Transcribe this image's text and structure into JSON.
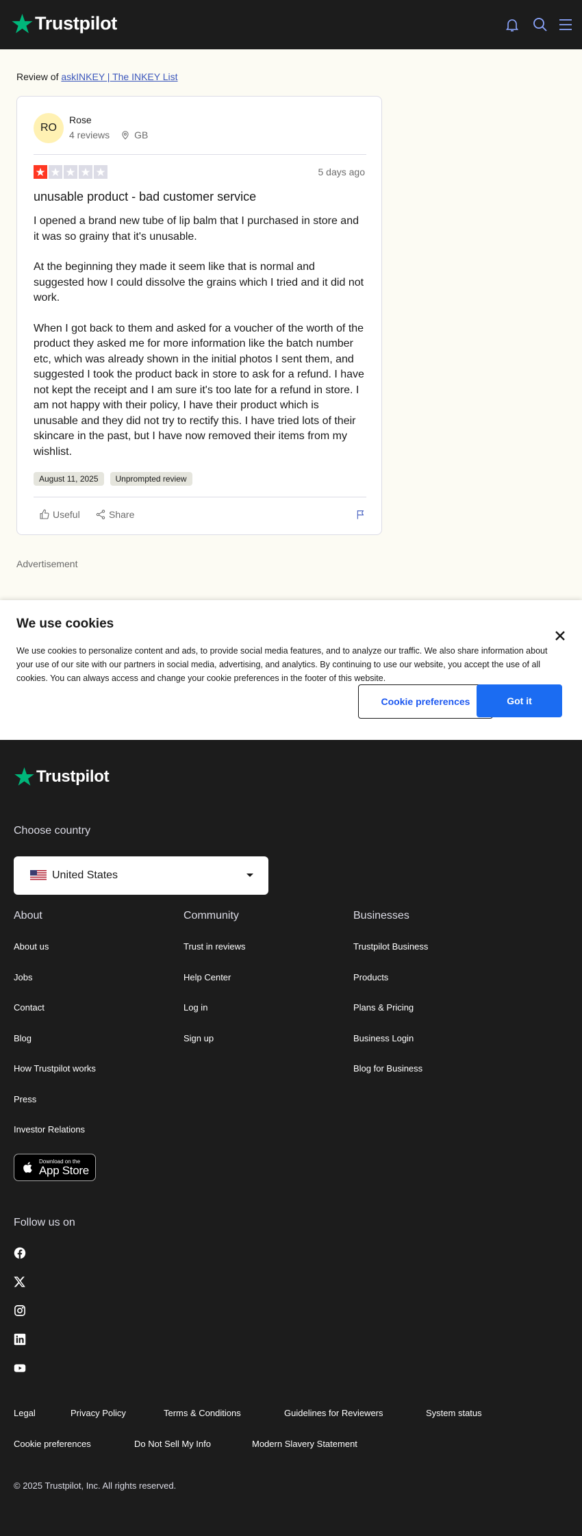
{
  "header": {
    "brand": "Trustpilot",
    "icons": [
      "bell-icon",
      "search-icon",
      "menu-icon"
    ],
    "colors": {
      "background": "#1c1c1c",
      "star_green": "#00b67a",
      "icon_blue": "#8ca6ff"
    }
  },
  "review_of": {
    "prefix": "Review of",
    "company": "askINKEY | The INKEY List"
  },
  "review": {
    "reviewer": {
      "initials": "RO",
      "name": "Rose",
      "review_count": "4 reviews",
      "country": "GB"
    },
    "rating": 1,
    "rating_color": "#ff3722",
    "age": "5 days ago",
    "title": "unusable product - bad customer service",
    "paragraphs": [
      "I opened a brand new tube of lip balm that I purchased in store and it was so grainy that it's unusable.",
      "At the beginning they made it seem like that is normal and suggested how I could dissolve the grains which I tried and it did not work.",
      "When I got back to them and asked for a voucher of the worth of the product they asked me for more information like the batch number etc, which was already shown in the initial photos I sent them, and suggested I took the product back in store to ask for a refund. I have not kept the receipt and I am sure it's too late for a refund in store. I am not happy with their policy, I have their product which is unusable and they did not try to rectify this. I have tried lots of their skincare in the past, but I have now removed their items from my wishlist."
    ],
    "date_tag": "August 11, 2025",
    "type_tag": "Unprompted review",
    "useful_label": "Useful",
    "share_label": "Share"
  },
  "advertisement_label": "Advertisement",
  "cookie_banner": {
    "title": "We use cookies",
    "text": "We use cookies to personalize content and ads, to provide social media features, and to analyze our traffic. We also share information about your use of our site with our partners in social media, advertising, and analytics. By continuing to use our website, you accept the use of all cookies. You can always access and change your cookie preferences in the footer of this website.",
    "preferences_label": "Cookie preferences",
    "accept_label": "Got it"
  },
  "footer": {
    "brand": "Trustpilot",
    "choose_country": "Choose country",
    "country_selected": "United States",
    "columns": {
      "about": {
        "heading": "About",
        "links": [
          "About us",
          "Jobs",
          "Contact",
          "Blog",
          "How Trustpilot works",
          "Press",
          "Investor Relations"
        ]
      },
      "community": {
        "heading": "Community",
        "links": [
          "Trust in reviews",
          "Help Center",
          "Log in",
          "Sign up"
        ]
      },
      "businesses": {
        "heading": "Businesses",
        "links": [
          "Trustpilot Business",
          "Products",
          "Plans & Pricing",
          "Business Login",
          "Blog for Business"
        ]
      }
    },
    "app_store": {
      "small": "Download on the",
      "big": "App Store"
    },
    "follow_us": "Follow us on",
    "social": [
      "facebook-icon",
      "x-icon",
      "instagram-icon",
      "linkedin-icon",
      "youtube-icon"
    ],
    "legal_row1": [
      "Legal",
      "Privacy Policy",
      "Terms & Conditions",
      "Guidelines for Reviewers",
      "System status"
    ],
    "legal_row2": [
      "Cookie preferences",
      "Do Not Sell My Info",
      "Modern Slavery Statement"
    ],
    "copyright": "© 2025 Trustpilot, Inc. All rights reserved."
  }
}
